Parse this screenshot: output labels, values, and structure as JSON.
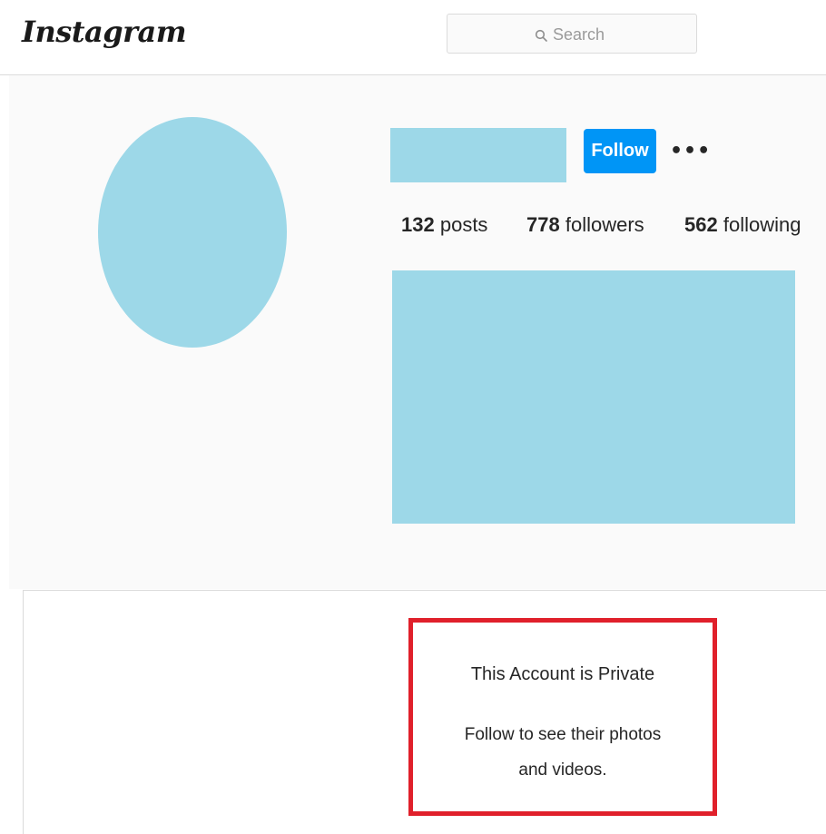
{
  "header": {
    "logo_text": "Instagram",
    "search": {
      "placeholder": "Search",
      "value": ""
    }
  },
  "profile": {
    "follow_label": "Follow",
    "more_label": "•••",
    "stats": {
      "posts_count": "132",
      "posts_label": "posts",
      "followers_count": "778",
      "followers_label": "followers",
      "following_count": "562",
      "following_label": "following"
    }
  },
  "private": {
    "title": "This Account is Private",
    "description": "Follow to see their photos and videos."
  },
  "colors": {
    "placeholder_block": "#9dd8e8",
    "follow_button": "#0095f6",
    "highlight_border": "#e0202b",
    "profile_background": "#fafafa"
  },
  "icons": {
    "search": "search-icon",
    "more": "more-options-icon"
  }
}
